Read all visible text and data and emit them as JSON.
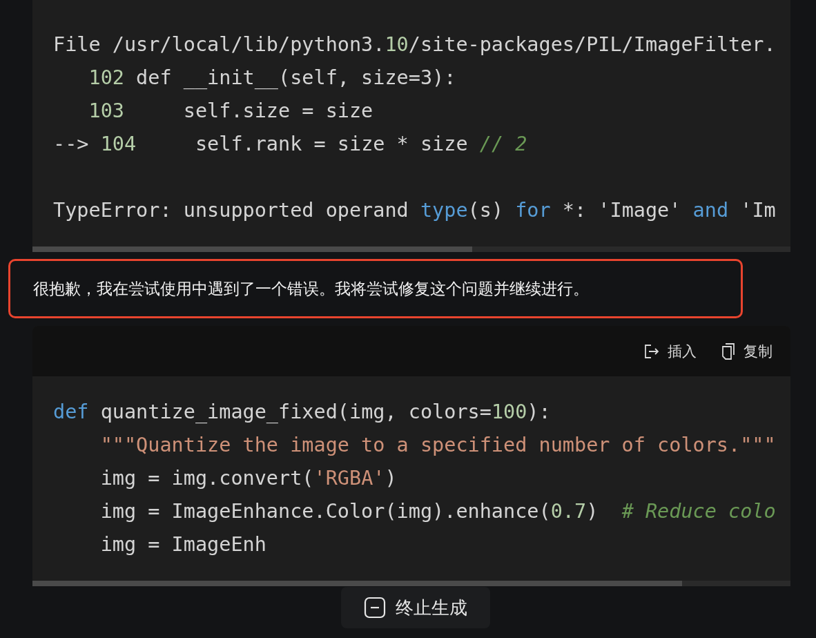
{
  "traceback_block": {
    "lines": [
      [
        {
          "text": "File /usr/local/lib/python3.",
          "kind": "plain"
        },
        {
          "text": "10",
          "kind": "number"
        },
        {
          "text": "/site-packages/PIL/ImageFilter.",
          "kind": "plain"
        }
      ],
      [
        {
          "text": "   102",
          "kind": "number"
        },
        {
          "text": " def __init__(self, size=3):",
          "kind": "plain"
        }
      ],
      [
        {
          "text": "   103",
          "kind": "number"
        },
        {
          "text": "     self.size = size",
          "kind": "plain"
        }
      ],
      [
        {
          "text": "--> ",
          "kind": "plain"
        },
        {
          "text": "104",
          "kind": "number"
        },
        {
          "text": "     self.rank = size * size ",
          "kind": "plain"
        },
        {
          "text": "// 2",
          "kind": "comment"
        }
      ]
    ],
    "error": [
      {
        "text": "TypeError: unsupported operand ",
        "kind": "plain"
      },
      {
        "text": "type",
        "kind": "keyword"
      },
      {
        "text": "(s) ",
        "kind": "plain"
      },
      {
        "text": "for",
        "kind": "keyword"
      },
      {
        "text": " *: 'Image' ",
        "kind": "plain"
      },
      {
        "text": "and",
        "kind": "keyword"
      },
      {
        "text": " 'Im",
        "kind": "plain"
      }
    ]
  },
  "message": {
    "text": "很抱歉，我在尝试使用中遇到了一个错误。我将尝试修复这个问题并继续进行。",
    "highlighted": true
  },
  "code_block": {
    "actions": [
      {
        "label": "插入",
        "kind": "insert"
      },
      {
        "label": "复制",
        "kind": "copy"
      }
    ],
    "lines": [
      [
        {
          "text": "def",
          "kind": "keyword"
        },
        {
          "text": " quantize_image_fixed(img, colors=",
          "kind": "plain"
        },
        {
          "text": "100",
          "kind": "number"
        },
        {
          "text": "):",
          "kind": "plain"
        }
      ],
      [
        {
          "text": "    \"\"\"Quantize the image to a specified number of colors.\"\"\"",
          "kind": "string"
        }
      ],
      [
        {
          "text": "    img = img.convert(",
          "kind": "plain"
        },
        {
          "text": "'RGBA'",
          "kind": "string"
        },
        {
          "text": ")",
          "kind": "plain"
        }
      ],
      [
        {
          "text": "    img = ImageEnhance.Color(img).enhance(",
          "kind": "plain"
        },
        {
          "text": "0.7",
          "kind": "number"
        },
        {
          "text": ")  ",
          "kind": "plain"
        },
        {
          "text": "# Reduce colo",
          "kind": "comment"
        }
      ],
      [
        {
          "text": "    img = ImageEnh",
          "kind": "plain"
        }
      ]
    ]
  },
  "stop_button": {
    "label": "终止生成"
  }
}
